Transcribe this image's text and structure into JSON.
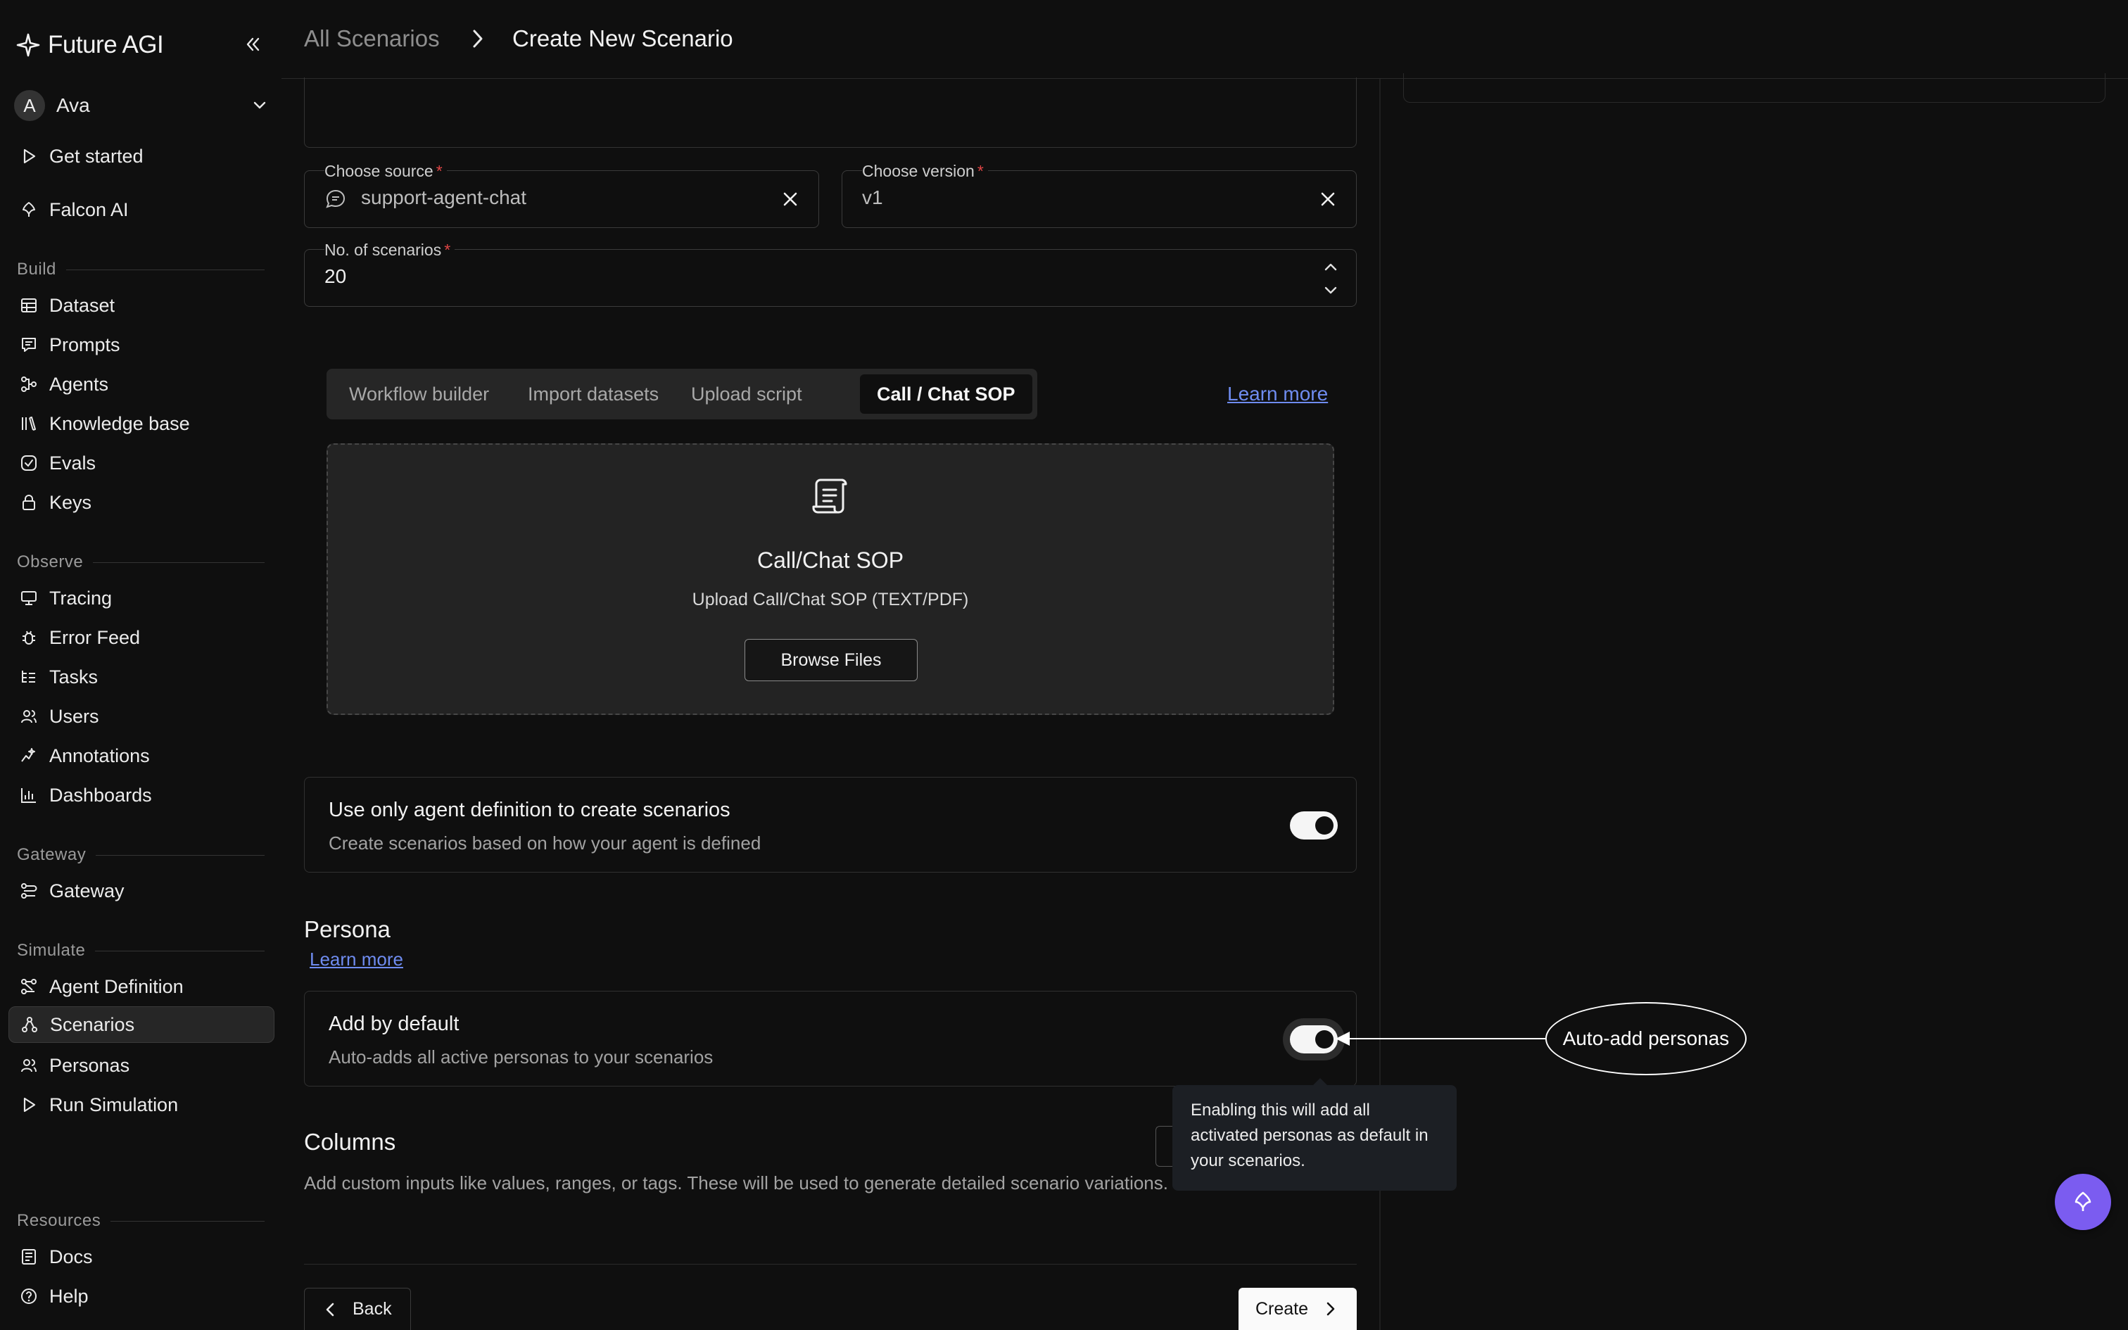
{
  "app": {
    "brand": "Future AGI"
  },
  "user": {
    "initial": "A",
    "name": "Ava"
  },
  "sidebar": {
    "top_items": [
      {
        "label": "Get started",
        "icon": "play-icon"
      },
      {
        "label": "Falcon AI",
        "icon": "falcon-icon"
      }
    ],
    "sections": [
      {
        "title": "Build",
        "items": [
          "Dataset",
          "Prompts",
          "Agents",
          "Knowledge base",
          "Evals",
          "Keys"
        ]
      },
      {
        "title": "Observe",
        "items": [
          "Tracing",
          "Error Feed",
          "Tasks",
          "Users",
          "Annotations",
          "Dashboards"
        ]
      },
      {
        "title": "Gateway",
        "items": [
          "Gateway"
        ]
      },
      {
        "title": "Simulate",
        "items": [
          "Agent Definition",
          "Scenarios",
          "Personas",
          "Run Simulation"
        ]
      },
      {
        "title": "Resources",
        "items": [
          "Docs",
          "Help"
        ]
      }
    ],
    "active_item": "Scenarios"
  },
  "breadcrumb": {
    "parent": "All Scenarios",
    "current": "Create New Scenario"
  },
  "form": {
    "source": {
      "label": "Choose source",
      "value": "support-agent-chat"
    },
    "version": {
      "label": "Choose version",
      "value": "v1"
    },
    "scenarios_count": {
      "label": "No. of scenarios",
      "value": "20"
    },
    "required_mark": "*"
  },
  "tabs": {
    "items": [
      "Workflow builder",
      "Import datasets",
      "Upload script",
      "Call / Chat SOP"
    ],
    "active": "Call / Chat SOP",
    "learn_more": "Learn more"
  },
  "upload": {
    "title": "Call/Chat SOP",
    "subtitle": "Upload Call/Chat SOP (TEXT/PDF)",
    "button": "Browse Files"
  },
  "agent_definition_toggle": {
    "title": "Use only agent definition to create scenarios",
    "subtitle": "Create scenarios based on how your agent is defined",
    "enabled": true
  },
  "persona": {
    "heading": "Persona",
    "learn_more": "Learn more",
    "add_default": {
      "title": "Add by default",
      "subtitle": "Auto-adds all active personas to your scenarios",
      "enabled": true
    }
  },
  "columns": {
    "heading": "Columns",
    "description": "Add custom inputs like values, ranges, or tags. These will be used to generate detailed scenario variations."
  },
  "tooltip": {
    "text": "Enabling this will add all activated personas as default in your scenarios."
  },
  "annotation": {
    "label": "Auto-add personas"
  },
  "footer": {
    "back": "Back",
    "create": "Create"
  },
  "colors": {
    "accent": "#7b5cf0",
    "link": "#6f8cf0",
    "required": "#e04545"
  }
}
